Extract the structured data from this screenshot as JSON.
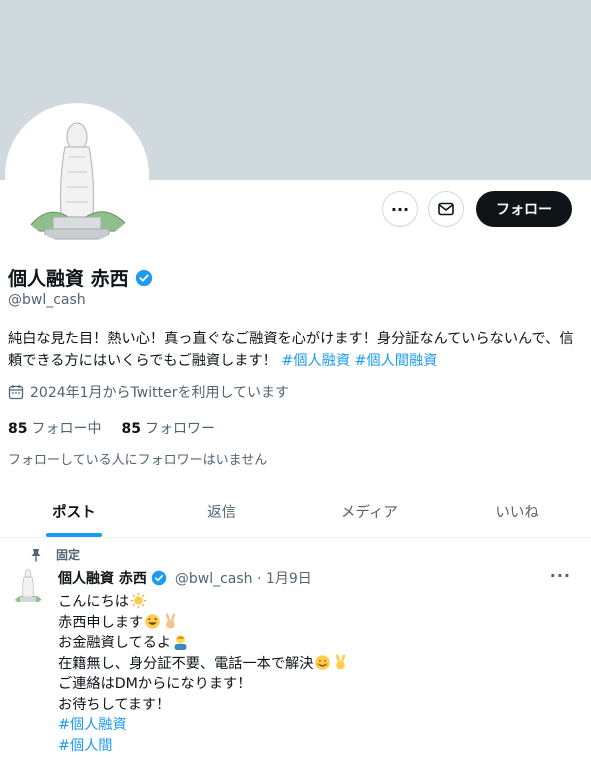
{
  "profile": {
    "name": "個人融資 赤西",
    "handle": "@bwl_cash",
    "bio_text": "純白な見た目！熱い心！真っ直ぐなご融資を心がけます！身分証なんていらないんで、信頼できる方にはいくらでもご融資します！ ",
    "bio_hashtags": [
      "#個人融資",
      "#個人間融資"
    ],
    "joined": "2024年1月からTwitterを利用しています",
    "following_count": "85",
    "following_label": "フォロー中",
    "followers_count": "85",
    "followers_label": "フォロワー",
    "no_followers_note": "フォローしている人にフォロワーはいません"
  },
  "actions": {
    "more_icon": "more-icon",
    "message_icon": "mail-icon",
    "follow_label": "フォロー"
  },
  "tabs": [
    {
      "label": "ポスト",
      "active": true
    },
    {
      "label": "返信",
      "active": false
    },
    {
      "label": "メディア",
      "active": false
    },
    {
      "label": "いいね",
      "active": false
    }
  ],
  "post": {
    "pinned_label": "固定",
    "author_name": "個人融資 赤西",
    "author_handle": "@bwl_cash",
    "date": "1月9日",
    "lines": [
      "こんにちは",
      "赤西申します",
      "お金融資してるよ",
      "在籍無し、身分証不要、電話一本で解決",
      "ご連絡はDMからになります！",
      "お待ちしてます！"
    ],
    "hashtags": [
      "#個人融資",
      "#個人間"
    ]
  },
  "colors": {
    "accent": "#1d9bf0",
    "banner": "#cfd9de",
    "text_primary": "#0f1419",
    "text_secondary": "#536471"
  }
}
